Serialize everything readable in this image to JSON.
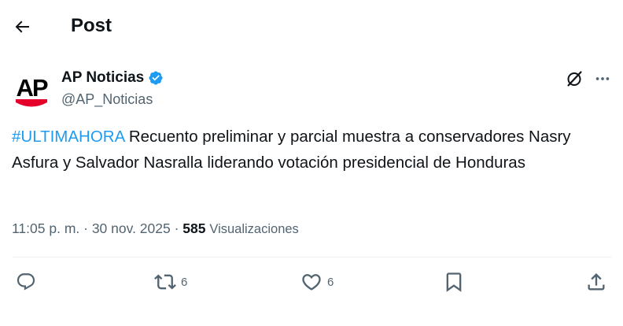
{
  "header": {
    "title": "Post"
  },
  "author": {
    "logo_text": "AP",
    "display_name": "AP Noticias",
    "handle": "@AP_Noticias"
  },
  "post": {
    "hashtag": "#ULTIMAHORA",
    "text": " Recuento preliminar y parcial muestra a conservadores Nasry Asfura y Salvador Nasralla liderando votación presidencial de Honduras",
    "time": "11:05 p. m.",
    "separator": " · ",
    "date": "30 nov. 2025",
    "views_count": "585",
    "views_label": "Visualizaciones"
  },
  "actions": {
    "reply_count": "",
    "retweet_count": "6",
    "like_count": "6"
  },
  "icons": {
    "back": "arrow-left-icon",
    "verified": "verified-badge-icon",
    "grok": "grok-icon",
    "more": "more-horizontal-icon",
    "reply": "reply-icon",
    "retweet": "retweet-icon",
    "like": "heart-icon",
    "bookmark": "bookmark-icon",
    "share": "share-icon"
  },
  "colors": {
    "accent": "#1d9bf0",
    "text": "#0f1419",
    "secondary": "#536471",
    "ap_red": "#e4002b"
  }
}
